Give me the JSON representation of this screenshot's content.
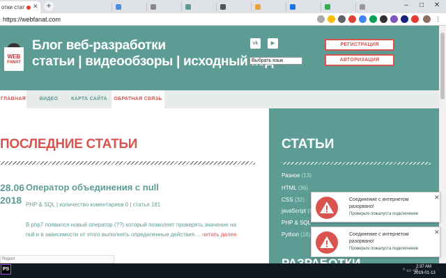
{
  "browser": {
    "active_tab_title": "отки статьи",
    "background_tabs": [
      "",
      "",
      "",
      "",
      "",
      "",
      "",
      ""
    ],
    "url": "https://webfanat.com",
    "window_controls": [
      "–",
      "□",
      "✕"
    ]
  },
  "header": {
    "logo_line1": "WEB",
    "logo_line2": "FANAT",
    "title_line1": "Блог веб-разработки",
    "title_line2": "статьи | видеообзоры | исходный код",
    "social_vk": "vk",
    "social_youtube": "▶",
    "language_select": "Выбрать язык",
    "register_label": "РЕГИСТРАЦИЯ",
    "login_label": "АВТОРИЗАЦИЯ"
  },
  "nav": {
    "items": [
      "ГЛАВНАЯ",
      "ВИДЕО",
      "КАРТА САЙТА",
      "ОБРАТНАЯ СВЯЗЬ"
    ]
  },
  "main": {
    "section_title": "ПОСЛЕДНИЕ СТАТЬИ",
    "post": {
      "date_line1": "28.06",
      "date_line2": "2018",
      "title": "Оператор объединения с null",
      "meta": "PHP & SQL | количество коментариев 0 | статья 181",
      "body_line1": "В php7 появился новый оператор (??) который позволяет проверять значение на",
      "body_line2": "null и в зависимости от этого выполнять определенные действия. ..",
      "read_more": ".читать далее"
    },
    "report_label": "Report"
  },
  "sidebar": {
    "title": "СТАТЬИ",
    "categories": [
      {
        "name": "Разное",
        "count": "(13)"
      },
      {
        "name": "HTML",
        "count": "(36)"
      },
      {
        "name": "CSS",
        "count": "(32)"
      },
      {
        "name": "javaScript",
        "count": "(6"
      },
      {
        "name": "PHP & SQL",
        "count": ""
      },
      {
        "name": "Python",
        "count": "(16)"
      }
    ],
    "title2": "РАЗРАБОТКИ"
  },
  "notifications": [
    {
      "line1": "Соединение с интернетом",
      "line2": "разорвано!",
      "hint": "Проверьте пожалуста подключение"
    },
    {
      "line1": "Соединение с интернетом",
      "line2": "разорвано!",
      "hint": "Проверьте пожалуста подключение"
    }
  ],
  "taskbar": {
    "app_icon": "PS",
    "tray": "^ ▭ ◁)",
    "time": "2:37 AM",
    "date": "2019-01-13"
  },
  "colors": {
    "teal": "#5d9c95",
    "red": "#d9534f"
  }
}
